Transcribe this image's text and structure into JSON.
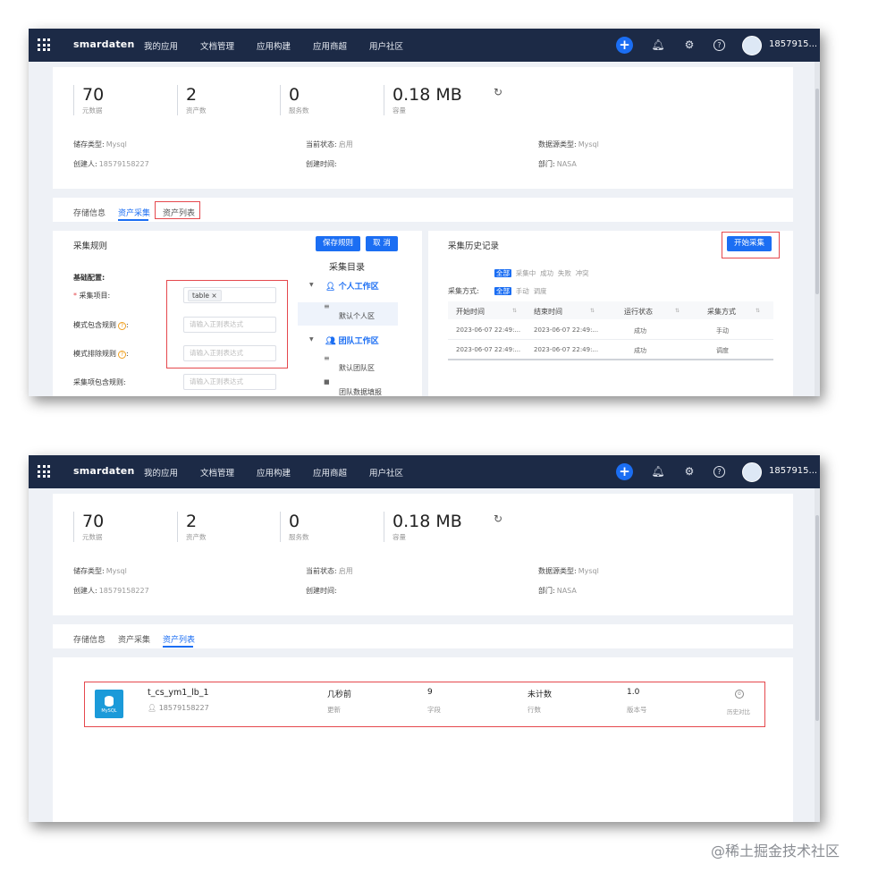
{
  "topbar": {
    "brand": "smardaten",
    "nav": [
      "我的应用",
      "文档管理",
      "应用构建",
      "应用商超",
      "用户社区"
    ],
    "plus": "+",
    "username": "1857915..."
  },
  "stats": [
    {
      "value": "70",
      "label": "元数据"
    },
    {
      "value": "2",
      "label": "资产数"
    },
    {
      "value": "0",
      "label": "服务数"
    },
    {
      "value": "0.18 MB",
      "label": "容量"
    }
  ],
  "meta": {
    "storage_type": {
      "label": "储存类型:",
      "value": "Mysql"
    },
    "status": {
      "label": "当前状态:",
      "value": "启用"
    },
    "source_type": {
      "label": "数据源类型:",
      "value": "Mysql"
    },
    "creator": {
      "label": "创建人:",
      "value": "18579158227"
    },
    "created_time": {
      "label": "创建时间:",
      "value": ""
    },
    "department": {
      "label": "部门:",
      "value": "NASA"
    }
  },
  "tabs": [
    "存储信息",
    "资产采集",
    "资产列表"
  ],
  "collect": {
    "title": "采集规则",
    "save": "保存规则",
    "cancel": "取 消",
    "section": "基础配置:",
    "project_label": "采集项目:",
    "tag": "table",
    "tag_close": "×",
    "include_label": "模式包含规则",
    "exclude_label": "模式排除规则",
    "item_include_label": "采集项包含规则:",
    "placeholder": "请输入正则表达式",
    "q": "?"
  },
  "directory": {
    "title": "采集目录",
    "personal": "个人工作区",
    "personal_default": "默认个人区",
    "team": "团队工作区",
    "team_default": "默认团队区",
    "team_data": "团队数据填报"
  },
  "history": {
    "title": "采集历史记录",
    "start": "开始采集",
    "status_filters": [
      "全部",
      "采集中",
      "成功",
      "失败",
      "冲突"
    ],
    "mode_label": "采集方式:",
    "mode_filters": [
      "全部",
      "手动",
      "调度"
    ],
    "columns": [
      "开始时间",
      "结束时间",
      "运行状态",
      "采集方式"
    ],
    "rows": [
      [
        "2023-06-07 22:49:...",
        "2023-06-07 22:49:...",
        "成功",
        "手动"
      ],
      [
        "2023-06-07 22:49:...",
        "2023-06-07 22:49:...",
        "成功",
        "调度"
      ]
    ]
  },
  "asset": {
    "icon_caption": "MySQL",
    "name": "t_cs_ym1_lb_1",
    "user": "18579158227",
    "updated": "几秒前",
    "updated_label": "更新",
    "fields": "9",
    "fields_label": "字段",
    "rows": "未计数",
    "rows_label": "行数",
    "version": "1.0",
    "version_label": "版本号",
    "history": "历史对比"
  },
  "watermark": "@稀土掘金技术社区"
}
